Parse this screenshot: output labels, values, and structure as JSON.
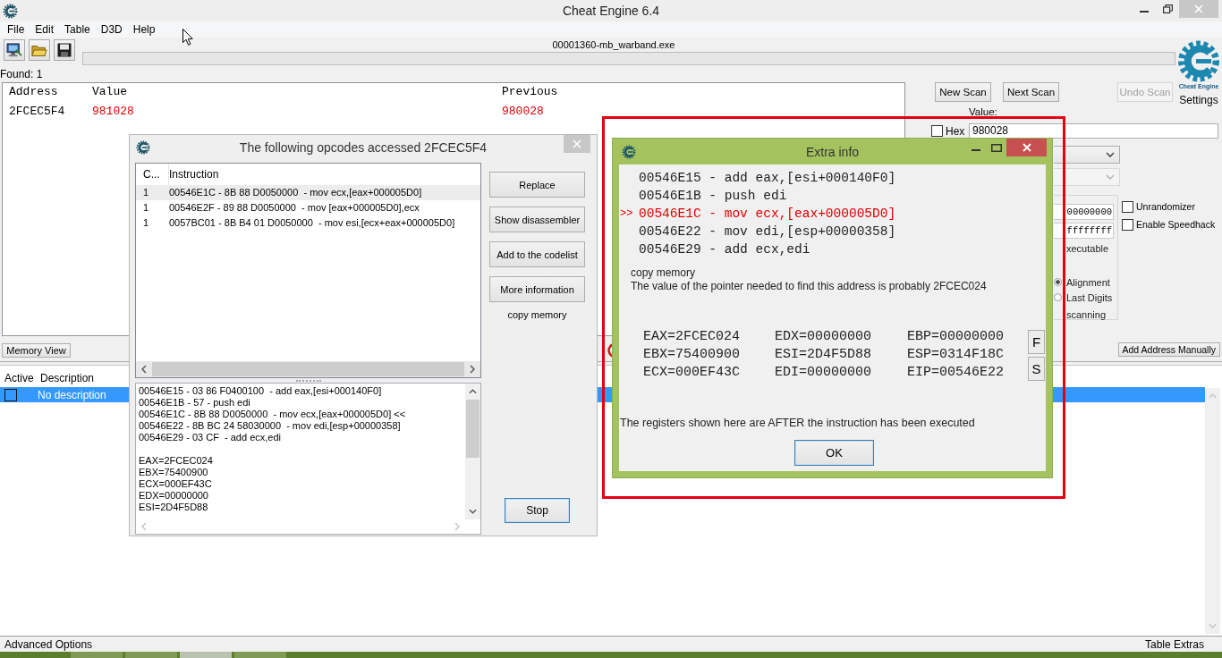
{
  "window": {
    "title": "Cheat Engine 6.4"
  },
  "menu": [
    {
      "label": "File"
    },
    {
      "label": "Edit"
    },
    {
      "label": "Table"
    },
    {
      "label": "D3D"
    },
    {
      "label": "Help"
    }
  ],
  "toolbar": {
    "process": "00001360-mb_warband.exe",
    "progress": {
      "level": 0
    }
  },
  "found": "Found: 1",
  "logo": {
    "caption": "Cheat Engine",
    "settings": "Settings"
  },
  "results": {
    "columns": [
      "Address",
      "Value",
      "Previous"
    ],
    "rows": [
      {
        "address": "2FCEC5F4",
        "value": "981028",
        "previous": "980028",
        "changed": true
      }
    ]
  },
  "scan": {
    "buttons": [
      {
        "label": "New Scan",
        "disabled": false
      },
      {
        "label": "Next Scan",
        "disabled": false
      },
      {
        "label": "Undo Scan",
        "disabled": true
      }
    ],
    "value_label": "Value:",
    "hex": {
      "label": "Hex",
      "checked": false
    },
    "value": "980028",
    "dropdowns": [
      {
        "disabled": false
      },
      {
        "disabled": true
      }
    ],
    "memory_options": {
      "start": "00000000",
      "stop": "ffffffff",
      "executable": "xecutable",
      "radios": [
        {
          "label": "Alignment",
          "selected": true
        },
        {
          "label": "Last Digits",
          "selected": false
        }
      ],
      "scanning": "scanning"
    },
    "options": [
      {
        "label": "Unrandomizer",
        "checked": false
      },
      {
        "label": "Enable Speedhack",
        "checked": false
      }
    ]
  },
  "memory_view": "Memory View",
  "add_address": "Add Address Manually",
  "address_table": {
    "columns": [
      "Active",
      "Description"
    ],
    "rows": [
      {
        "active": false,
        "description": "No description",
        "selected": true
      }
    ]
  },
  "footer": {
    "advanced": "Advanced Options",
    "extras": "Table Extras"
  },
  "opcodes_dialog": {
    "active": false,
    "title": "The following opcodes accessed 2FCEC5F4",
    "columns": [
      "C...",
      "Instruction"
    ],
    "rows": [
      {
        "count": "1",
        "instruction": "00546E1C - 8B 88 D0050000  - mov ecx,[eax+000005D0]",
        "selected": true
      },
      {
        "count": "1",
        "instruction": "00546E2F - 89 88 D0050000  - mov [eax+000005D0],ecx",
        "selected": false
      },
      {
        "count": "1",
        "instruction": "0057BC01 - 8B B4 01 D0050000  - mov esi,[ecx+eax+000005D0]",
        "selected": false
      }
    ],
    "code_lines": [
      "00546E15 - 03 86 F0400100  - add eax,[esi+000140F0]",
      "00546E1B - 57 - push edi",
      "00546E1C - 8B 88 D0050000  - mov ecx,[eax+000005D0] <<",
      "00546E22 - 8B BC 24 58030000  - mov edi,[esp+00000358]",
      "00546E29 - 03 CF  - add ecx,edi"
    ],
    "register_lines": [
      "EAX=2FCEC024",
      "EBX=75400900",
      "ECX=000EF43C",
      "EDX=00000000",
      "ESI=2D4F5D88"
    ],
    "buttons": [
      "Replace",
      "Show disassembler",
      "Add to the codelist",
      "More information"
    ],
    "note": "copy memory",
    "stop": {
      "label": "Stop",
      "focused": true
    }
  },
  "extra_info": {
    "active": true,
    "title": "Extra info",
    "lines": [
      {
        "text": "00546E15 - add eax,[esi+000140F0]",
        "current": false
      },
      {
        "text": "00546E1B - push edi",
        "current": false
      },
      {
        "marker": ">>",
        "text": "00546E1C - mov ecx,[eax+000005D0]",
        "current": true
      },
      {
        "text": "00546E22 - mov edi,[esp+00000358]",
        "current": false
      },
      {
        "text": "00546E29 - add ecx,edi",
        "current": false
      }
    ],
    "note": "copy memory",
    "pointer": "The value of the pointer needed to find this address is probably 2FCEC024",
    "registers": [
      [
        "EAX=2FCEC024",
        "EBX=75400900",
        "ECX=000EF43C"
      ],
      [
        "EDX=00000000",
        "ESI=2D4F5D88",
        "EDI=00000000"
      ],
      [
        "EBP=00000000",
        "ESP=0314F18C",
        "EIP=00546E22"
      ]
    ],
    "side_buttons": [
      "F",
      "S"
    ],
    "footnote": "The registers shown here are AFTER the instruction has been executed",
    "ok": {
      "label": "OK",
      "focused": true
    }
  },
  "taskbar": {
    "buttons": [
      {
        "selected": false
      },
      {
        "selected": false
      },
      {
        "selected": true
      },
      {
        "selected": false
      }
    ]
  }
}
